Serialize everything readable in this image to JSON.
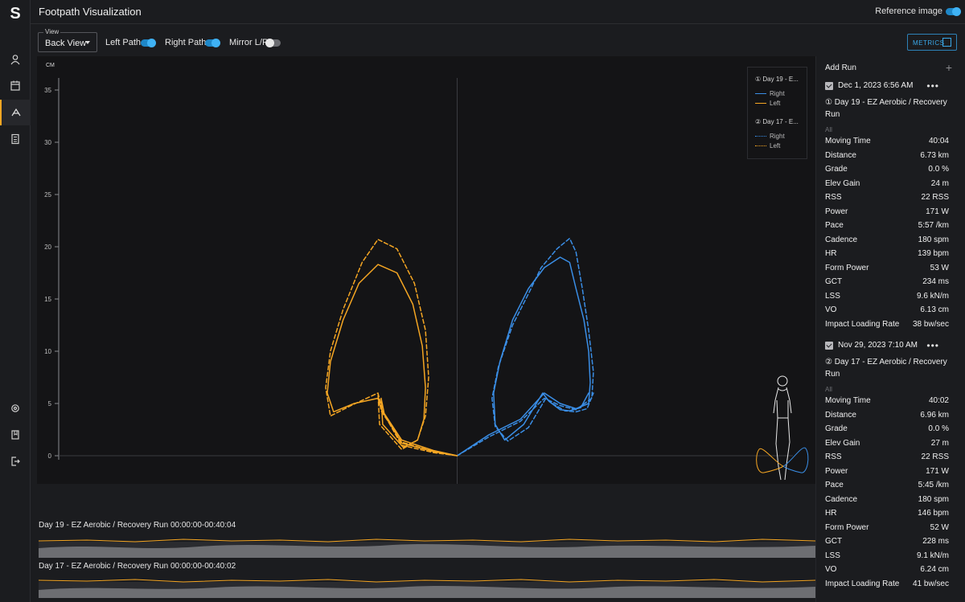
{
  "app": {
    "logo": "S",
    "title": "Footpath Visualization",
    "reference_image_label": "Reference image",
    "reference_image_on": true
  },
  "nav": [
    {
      "icon": "user-icon"
    },
    {
      "icon": "calendar-icon"
    },
    {
      "icon": "footpath-icon",
      "active": true
    },
    {
      "icon": "calculator-icon"
    },
    {
      "icon": "gear-icon"
    },
    {
      "icon": "book-icon"
    },
    {
      "icon": "logout-icon"
    }
  ],
  "controls": {
    "view_legend": "View",
    "view_value": "Back View",
    "left_path_label": "Left Path",
    "left_path_on": true,
    "right_path_label": "Right Path",
    "right_path_on": true,
    "mirror_label": "Mirror L/R",
    "mirror_on": false,
    "metrics_label": "METRICS"
  },
  "colors": {
    "right": "#3a8ee6",
    "left": "#f5a623",
    "accent": "#3aa8e8",
    "active_nav": "#f5a623"
  },
  "legend": {
    "groups": [
      {
        "title": "① Day 19 - E...",
        "right_label": "Right",
        "left_label": "Left",
        "style": "solid"
      },
      {
        "title": "② Day 17 - E...",
        "right_label": "Right",
        "left_label": "Left",
        "style": "dotted"
      }
    ]
  },
  "chart_data": {
    "type": "line",
    "xlabel": "CM",
    "ylabel": "CM",
    "xlim": [
      -25,
      22
    ],
    "ylim": [
      -2.5,
      36
    ],
    "xticks": [
      -25,
      -20,
      -15,
      -10,
      -5,
      0,
      5,
      10,
      15,
      20
    ],
    "yticks": [
      0,
      5,
      10,
      15,
      20,
      25,
      30,
      35
    ],
    "series": [
      {
        "name": "① Day 19 Right",
        "style": "solid",
        "color": "#3a8ee6",
        "x": [
          0,
          2,
          4,
          5.5,
          6.5,
          7.5,
          8.3,
          8.4,
          8.3,
          8.0,
          7.5,
          7.1,
          6.5,
          5.5,
          4.5,
          3.5,
          2.7,
          2.3,
          2.4,
          3.0,
          4.2,
          5.4,
          5.8,
          6.5,
          7.1,
          7.8,
          8.3
        ],
        "y": [
          0,
          2,
          3.5,
          6,
          5,
          4.5,
          5,
          7,
          10,
          13,
          16,
          18.5,
          19,
          18,
          16,
          13,
          9,
          6,
          3,
          1.5,
          3,
          6,
          5.2,
          4.4,
          4.3,
          4.6,
          6
        ]
      },
      {
        "name": "① Day 19 Left",
        "style": "solid",
        "color": "#f5a623",
        "x": [
          0,
          -1.5,
          -3.5,
          -4.8,
          -5.0,
          -6.5,
          -7.8,
          -8.2,
          -8.0,
          -7.2,
          -6.2,
          -5.0,
          -3.8,
          -2.8,
          -2.2,
          -2.0,
          -2.1,
          -2.5,
          -3.4,
          -4.7,
          -4.8,
          -4.6,
          -3.5,
          -1.5,
          0
        ],
        "y": [
          0,
          0.5,
          1.5,
          4.5,
          5.5,
          5.0,
          4.2,
          6,
          9,
          13,
          16.5,
          18.3,
          17.5,
          14.5,
          10.5,
          6.5,
          3.5,
          1.5,
          0.8,
          3,
          5.5,
          4.0,
          1.2,
          0.4,
          0
        ]
      },
      {
        "name": "② Day 17 Right",
        "style": "dashed",
        "color": "#3a8ee6",
        "x": [
          0,
          2,
          4,
          5.5,
          6.5,
          7.5,
          8.5,
          8.6,
          8.3,
          7.9,
          7.5,
          7.1,
          6.3,
          5.3,
          4.5,
          3.5,
          2.6,
          2.2,
          2.4,
          3.2,
          4.5,
          5.6,
          6.0,
          6.8,
          7.5,
          8.2,
          8.6
        ],
        "y": [
          0,
          1.8,
          3.3,
          5.5,
          4.8,
          4.4,
          5.5,
          8,
          12,
          16,
          19.5,
          20.8,
          19.8,
          18,
          15.5,
          12.5,
          8.5,
          5.5,
          2.8,
          1.4,
          2.7,
          5.5,
          5.0,
          4.3,
          4.2,
          4.5,
          6
        ]
      },
      {
        "name": "② Day 17 Left",
        "style": "dashed",
        "color": "#f5a623",
        "x": [
          0,
          -1.5,
          -3.5,
          -4.8,
          -5.0,
          -6.7,
          -8.0,
          -8.3,
          -8.0,
          -7.2,
          -6.0,
          -5.0,
          -3.8,
          -2.7,
          -2.0,
          -1.8,
          -2.0,
          -2.5,
          -3.5,
          -4.9,
          -5.0,
          -4.7,
          -3.5,
          -1.5,
          0
        ],
        "y": [
          0,
          0.4,
          1.3,
          4.3,
          6.0,
          4.8,
          3.8,
          6.5,
          10,
          14,
          18.5,
          20.7,
          19.8,
          16.5,
          12,
          7.5,
          3.8,
          1.5,
          0.6,
          3,
          6.0,
          4.2,
          1.0,
          0.3,
          0
        ]
      }
    ]
  },
  "runs_bottom": [
    {
      "label": "Day 19 - EZ Aerobic / Recovery Run  00:00:00-00:40:04"
    },
    {
      "label": "Day 17 - EZ Aerobic / Recovery Run  00:00:00-00:40:02"
    }
  ],
  "sidebar": {
    "add_run_label": "Add Run",
    "runs": [
      {
        "date": "Dec 1, 2023 6:56 AM",
        "name": "① Day 19 - EZ Aerobic / Recovery Run",
        "filter": "All",
        "metrics": [
          {
            "label": "Moving Time",
            "value": "40:04"
          },
          {
            "label": "Distance",
            "value": "6.73 km"
          },
          {
            "label": "Grade",
            "value": "0.0 %"
          },
          {
            "label": "Elev Gain",
            "value": "24 m"
          },
          {
            "label": "RSS",
            "value": "22 RSS"
          },
          {
            "label": "Power",
            "value": "171 W"
          },
          {
            "label": "Pace",
            "value": "5:57 /km"
          },
          {
            "label": "Cadence",
            "value": "180 spm"
          },
          {
            "label": "HR",
            "value": "139 bpm"
          },
          {
            "label": "Form Power",
            "value": "53 W"
          },
          {
            "label": "GCT",
            "value": "234 ms"
          },
          {
            "label": "LSS",
            "value": "9.6 kN/m"
          },
          {
            "label": "VO",
            "value": "6.13 cm"
          },
          {
            "label": "Impact Loading Rate",
            "value": "38 bw/sec"
          }
        ]
      },
      {
        "date": "Nov 29, 2023 7:10 AM",
        "name": "② Day 17 - EZ Aerobic / Recovery Run",
        "filter": "All",
        "metrics": [
          {
            "label": "Moving Time",
            "value": "40:02"
          },
          {
            "label": "Distance",
            "value": "6.96 km"
          },
          {
            "label": "Grade",
            "value": "0.0 %"
          },
          {
            "label": "Elev Gain",
            "value": "27 m"
          },
          {
            "label": "RSS",
            "value": "22 RSS"
          },
          {
            "label": "Power",
            "value": "171 W"
          },
          {
            "label": "Pace",
            "value": "5:45 /km"
          },
          {
            "label": "Cadence",
            "value": "180 spm"
          },
          {
            "label": "HR",
            "value": "146 bpm"
          },
          {
            "label": "Form Power",
            "value": "52 W"
          },
          {
            "label": "GCT",
            "value": "228 ms"
          },
          {
            "label": "LSS",
            "value": "9.1 kN/m"
          },
          {
            "label": "VO",
            "value": "6.24 cm"
          },
          {
            "label": "Impact Loading Rate",
            "value": "41 bw/sec"
          }
        ]
      }
    ]
  }
}
